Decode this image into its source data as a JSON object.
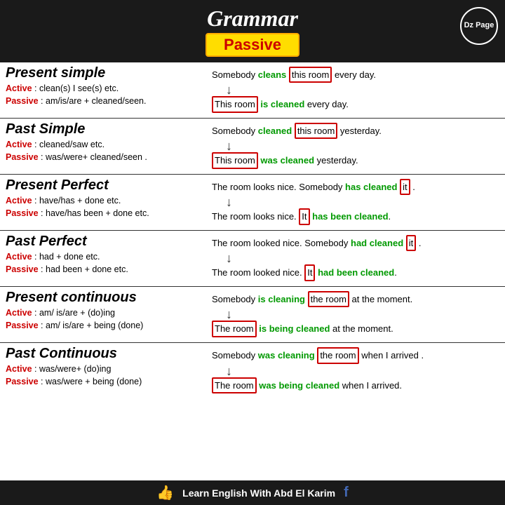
{
  "header": {
    "title": "Grammar",
    "passive_label": "Passive",
    "dz_badge": "Dz Page"
  },
  "sections": [
    {
      "id": "present-simple",
      "title": "Present simple",
      "active_label": "Active",
      "active_rule": ": clean(s) I see(s) etc.",
      "passive_label": "Passive",
      "passive_rule": ": am/is/are + cleaned/seen.",
      "example_top": "Somebody cleans this room every day.",
      "example_bottom": "This room is cleaned every day.",
      "top_box_word": "this room",
      "top_green_word": "cleans",
      "bottom_box_word": "This room",
      "bottom_green_word": "is cleaned"
    },
    {
      "id": "past-simple",
      "title": "Past Simple",
      "active_label": "Active",
      "active_rule": ": cleaned/saw etc.",
      "passive_label": "Passive",
      "passive_rule": ": was/were+ cleaned/seen .",
      "example_top": "Somebody cleaned this room yesterday.",
      "example_bottom": "This room was cleaned yesterday.",
      "top_box_word": "this room",
      "top_green_word": "cleaned",
      "bottom_box_word": "This room",
      "bottom_green_word": "was cleaned"
    },
    {
      "id": "present-perfect",
      "title": "Present Perfect",
      "active_label": "Active",
      "active_rule": ": have/has + done etc.",
      "passive_label": "Passive",
      "passive_rule": ": have/has been + done etc.",
      "example_top": "The room looks nice. Somebody has cleaned it .",
      "example_bottom": "The room looks nice. It has been cleaned.",
      "top_box_word": "it",
      "top_green_word": "has cleaned",
      "bottom_box_word": "It",
      "bottom_green_word": "has been cleaned"
    },
    {
      "id": "past-perfect",
      "title": "Past Perfect",
      "active_label": "Active",
      "active_rule": ": had + done etc.",
      "passive_label": "Passive",
      "passive_rule": ": had been + done etc.",
      "example_top": "The room looked nice. Somebody had cleaned it .",
      "example_bottom": "The room looked nice. It had been cleaned.",
      "top_box_word": "it",
      "top_green_word": "had cleaned",
      "bottom_box_word": "It",
      "bottom_green_word": "had been cleaned"
    },
    {
      "id": "present-continuous",
      "title": "Present continuous",
      "active_label": "Active",
      "active_rule": ": am/ is/are + (do)ing",
      "passive_label": "Passive",
      "passive_rule": ": am/ is/are + being (done)",
      "example_top": "Somebody is cleaning the room at the moment.",
      "example_bottom": "The room is being cleaned at the moment.",
      "top_box_word": "the room",
      "top_green_word": "is cleaning",
      "bottom_box_word": "The room",
      "bottom_green_word": "is being cleaned"
    },
    {
      "id": "past-continuous",
      "title": "Past Continuous",
      "active_label": "Active",
      "active_rule": ": was/were+ (do)ing",
      "passive_label": "Passive",
      "passive_rule": ": was/were + being (done)",
      "example_top": "Somebody was cleaning the room when I arrived .",
      "example_bottom": "The room was being cleaned when I arrived.",
      "top_box_word": "the room",
      "top_green_word": "was cleaning",
      "bottom_box_word": "The room",
      "bottom_green_word": "was being cleaned"
    }
  ],
  "footer": {
    "text": "Learn English With Abd El Karim"
  }
}
